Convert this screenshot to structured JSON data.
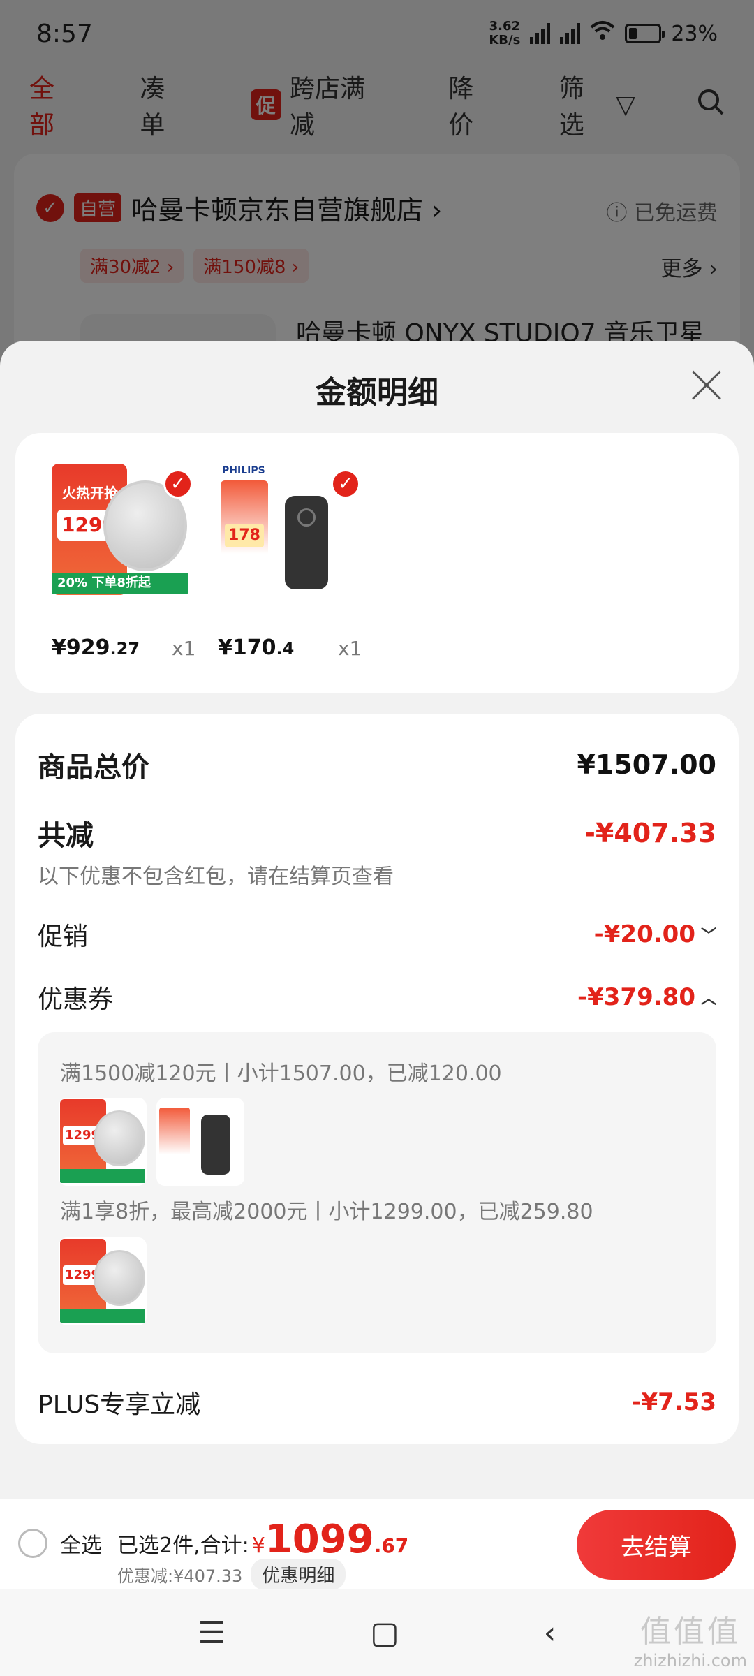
{
  "status_bar": {
    "time": "8:57",
    "net_speed": "3.62",
    "net_unit": "KB/s",
    "battery": "23%"
  },
  "bg_page": {
    "tabs": [
      "全部",
      "凑单",
      "促",
      "跨店满减",
      "降价",
      "筛选"
    ],
    "store_tag": "自营",
    "store_name": "哈曼卡顿京东自营旗舰店 ›",
    "free_shipping": "ⓘ 已免运费",
    "coupons": [
      "满30减2 ›",
      "满150减8 ›"
    ],
    "more": "更多 ›",
    "product_title": "哈曼卡顿 ONYX STUDIO7 音乐卫星"
  },
  "sheet": {
    "title": "金额明细",
    "products": [
      {
        "price_int": "¥929",
        "price_dec": ".27",
        "qty": "x1",
        "poster_text": "火热开抢",
        "poster_price": "1299",
        "promo": "20%  下单8折起",
        "icon": "speaker-icon"
      },
      {
        "price_int": "¥170",
        "price_dec": ".4",
        "qty": "x1",
        "brand": "PHILIPS",
        "poster_price": "178",
        "icon": "recorder-icon"
      }
    ],
    "summary": {
      "total_label": "商品总价",
      "total_value": "¥1507.00",
      "discount_label": "共减",
      "discount_value": "-¥407.33",
      "note": "以下优惠不包含红包，请在结算页查看",
      "promo_label": "促销",
      "promo_value": "-¥20.00",
      "coupon_label": "优惠券",
      "coupon_value": "-¥379.80",
      "coupon_details": [
        "满1500减120元丨小计1507.00，已减120.00",
        "满1享8折，最高减2000元丨小计1299.00，已减259.80"
      ],
      "plus_label": "PLUS专享立减",
      "plus_value": "-¥7.53"
    }
  },
  "bottom_bar": {
    "select_all": "全选",
    "selected_label": "已选2件,合计:",
    "yen": "¥",
    "total_int": "1099",
    "total_dec": ".67",
    "discount_text": "优惠减:¥407.33",
    "detail_pill": "优惠明细",
    "checkout": "去结算"
  },
  "nav": {
    "menu": "☰",
    "home": "▢",
    "back": "‹"
  },
  "watermark": {
    "logo": "值值值",
    "site": "zhizhizhi.com"
  },
  "colors": {
    "accent": "#e2231a",
    "green": "#1aa052"
  }
}
